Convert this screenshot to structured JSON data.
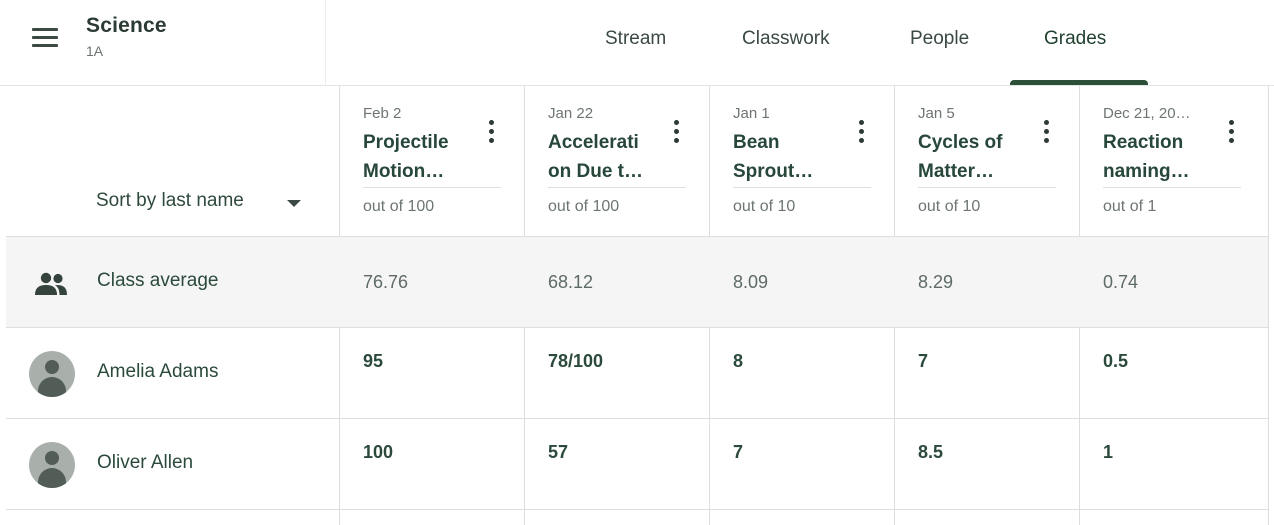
{
  "course": {
    "name": "Science",
    "section": "1A"
  },
  "tabs": [
    {
      "label": "Stream"
    },
    {
      "label": "Classwork"
    },
    {
      "label": "People"
    },
    {
      "label": "Grades",
      "active": true
    }
  ],
  "sort": {
    "label": "Sort by last name"
  },
  "assignments": [
    {
      "date": "Feb 2",
      "title_line1": "Projectile",
      "title_line2": "Motion…",
      "out_of": "out of 100"
    },
    {
      "date": "Jan 22",
      "title_line1": "Accelerati",
      "title_line2": "on Due t…",
      "out_of": "out of 100"
    },
    {
      "date": "Jan 1",
      "title_line1": "Bean",
      "title_line2": "Sprout…",
      "out_of": "out of 10"
    },
    {
      "date": "Jan 5",
      "title_line1": "Cycles of",
      "title_line2": "Matter…",
      "out_of": "out of 10"
    },
    {
      "date": "Dec 21, 20…",
      "title_line1": "Reaction",
      "title_line2": "naming…",
      "out_of": "out of 1"
    }
  ],
  "class_average": {
    "label": "Class average",
    "values": [
      "76.76",
      "68.12",
      "8.09",
      "8.29",
      "0.74"
    ]
  },
  "students": [
    {
      "name": "Amelia Adams",
      "grades": [
        "95",
        "78/100",
        "8",
        "7",
        "0.5"
      ]
    },
    {
      "name": "Oliver Allen",
      "grades": [
        "100",
        "57",
        "7",
        "8.5",
        "1"
      ]
    }
  ],
  "colors": {
    "accent": "#2c4f3a",
    "text": "#27473a",
    "muted": "#6d7571",
    "row_highlight": "#f5f5f5"
  }
}
